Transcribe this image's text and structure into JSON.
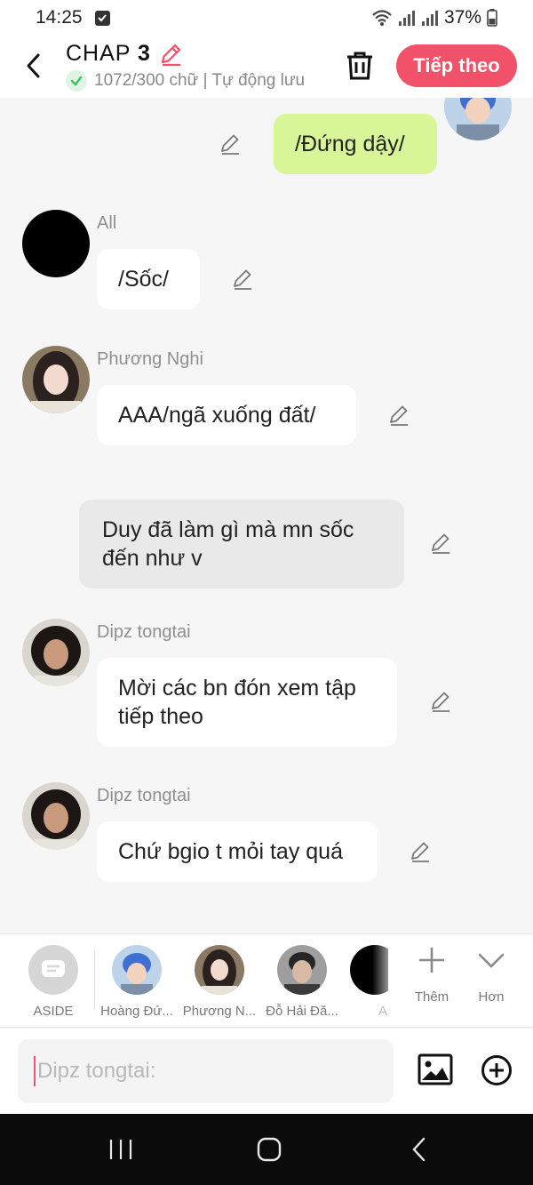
{
  "status_bar": {
    "time": "14:25",
    "battery": "37%"
  },
  "header": {
    "title": "CHAP",
    "number": "3",
    "autosave_text": "1072/300 chữ | Tự động lưu",
    "next_button": "Tiếp theo"
  },
  "messages": [
    {
      "text": "/Đứng dậy/"
    },
    {
      "sender": "All",
      "text": "/Sốc/"
    },
    {
      "sender": "Phương Nghi",
      "text": "AAA/ngã xuống đất/"
    },
    {
      "text_line1": "Duy đã làm gì mà mn sốc",
      "text_line2": "đến như v"
    },
    {
      "sender": "Dipz tongtai",
      "text_line1": "Mời các bn đón xem tập",
      "text_line2": "tiếp theo"
    },
    {
      "sender": "Dipz tongtai",
      "text": "Chứ bgio t mỏi tay quá"
    }
  ],
  "characters": [
    {
      "label": "ASIDE"
    },
    {
      "label": "Hoàng Đứ..."
    },
    {
      "label": "Phương N..."
    },
    {
      "label": "Đỗ Hải Đă..."
    },
    {
      "label": "A"
    }
  ],
  "tools": {
    "add": "Thêm",
    "more": "Hơn"
  },
  "composer": {
    "placeholder": "Dipz tongtai:"
  },
  "colors": {
    "accent": "#f2516a",
    "green_bubble": "#d8f598",
    "ok_green": "#3cc15a"
  },
  "icons": [
    "back-icon",
    "pencil-icon",
    "check-icon",
    "trash-icon",
    "edit-icon",
    "plus-icon",
    "chevron-down-icon",
    "image-icon",
    "plus-circle-icon",
    "recents-icon",
    "home-icon",
    "back-nav-icon",
    "wifi-icon",
    "signal-icon",
    "battery-icon"
  ]
}
